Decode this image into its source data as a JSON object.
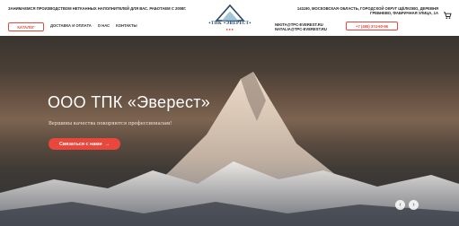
{
  "header": {
    "tagline": "ЗАНИМАЕМСЯ ПРОИЗВОДСТВОМ НЕТКАННЫХ НАПОЛНИТЕЛЕЙ ДЛЯ ВАС. РАБОТАЕМ С 2008Г.",
    "catalog_label": "КАТАЛОГ",
    "nav": [
      "ДОСТАВКА И ОПЛАТА",
      "О НАС",
      "КОНТАКТЫ"
    ],
    "logo_text": "•ТПК •ЭВЕРЕСТ•",
    "logo_dots": "●●●",
    "address": "141190, МОСКОВСКАЯ ОБЛАСТЬ, ГОРОДСКОЙ ОКРУГ ЩЁЛКОВО, ДЕРЕВНЯ ГРЕБНЕВО, ФАБРИЧНАЯ УЛИЦА, 1А",
    "email1": "NIKITA@TPC-EVEREST.RU",
    "email2": "NATALIA@TPC-EVEREST.RU",
    "phone": "+7 (495) 374-60-96"
  },
  "hero": {
    "title": "ООО ТПК «Эверест»",
    "subtitle": "Вершины качества покоряются профессионалам!",
    "cta_label": "Связаться с нами",
    "cta_arrow": "→",
    "prev_symbol": "‹",
    "next_symbol": "›"
  },
  "colors": {
    "accent": "#e9473b",
    "logo": "#2a4a6a"
  },
  "icons": {
    "cart": "cart-icon",
    "logo": "mountain-logo-icon"
  }
}
